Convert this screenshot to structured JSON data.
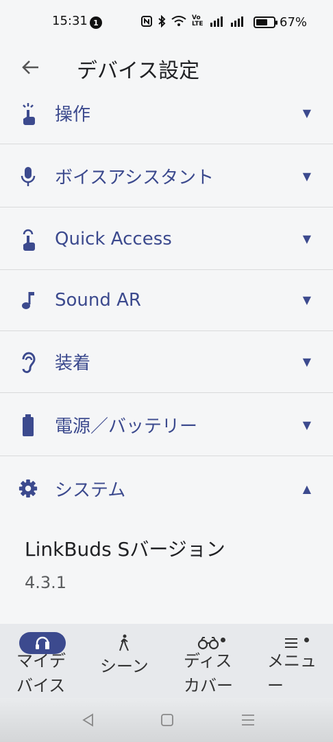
{
  "status_bar": {
    "time": "15:31",
    "notification_count": "1",
    "battery_percent": "67%",
    "battery_level": 0.67,
    "network_label": "Vo LTE"
  },
  "header": {
    "back_icon": "arrow-left-icon",
    "title": "デバイス設定"
  },
  "sections": [
    {
      "label": "操作",
      "icon": "touch-icon",
      "expanded": false
    },
    {
      "label": "ボイスアシスタント",
      "icon": "microphone-icon",
      "expanded": false
    },
    {
      "label": "Quick Access",
      "icon": "quick-access-icon",
      "expanded": false
    },
    {
      "label": "Sound AR",
      "icon": "music-note-icon",
      "expanded": false
    },
    {
      "label": "装着",
      "icon": "ear-icon",
      "expanded": false
    },
    {
      "label": "電源／バッテリー",
      "icon": "battery-icon",
      "expanded": false
    },
    {
      "label": "システム",
      "icon": "gear-icon",
      "expanded": true
    }
  ],
  "system": {
    "version_label": "LinkBuds Sバージョン",
    "version_value": "4.3.1"
  },
  "bottom_nav": {
    "items": [
      {
        "label": "マイデ\nバイス",
        "icon": "headphones-icon",
        "active": true
      },
      {
        "label": "シーン",
        "icon": "walking-person-icon",
        "active": false
      },
      {
        "label": "ディス\nカバー",
        "icon": "binoculars-icon",
        "active": false
      },
      {
        "label": "メニュ\nー",
        "icon": "menu-icon",
        "active": false
      }
    ]
  },
  "colors": {
    "accent": "#3c4a8e",
    "background": "#f5f6f7",
    "nav_background": "#e7e9ec"
  }
}
